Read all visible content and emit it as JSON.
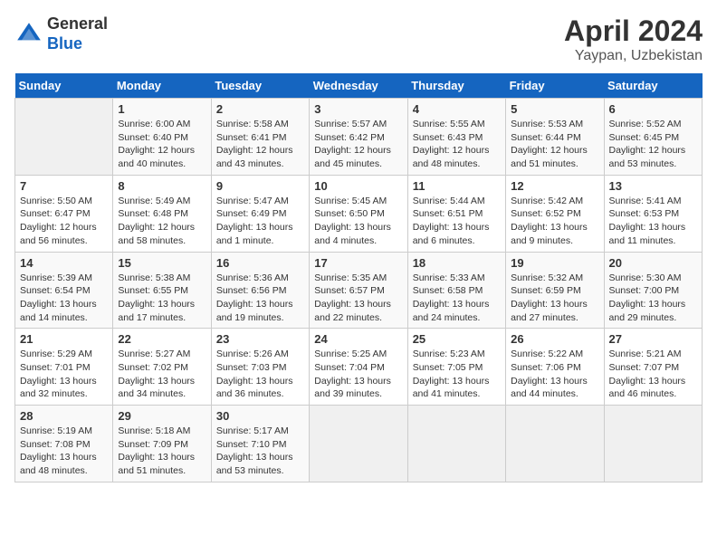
{
  "header": {
    "logo_general": "General",
    "logo_blue": "Blue",
    "title": "April 2024",
    "subtitle": "Yaypan, Uzbekistan"
  },
  "calendar": {
    "days_of_week": [
      "Sunday",
      "Monday",
      "Tuesday",
      "Wednesday",
      "Thursday",
      "Friday",
      "Saturday"
    ],
    "weeks": [
      [
        {
          "day": "",
          "info": ""
        },
        {
          "day": "1",
          "info": "Sunrise: 6:00 AM\nSunset: 6:40 PM\nDaylight: 12 hours\nand 40 minutes."
        },
        {
          "day": "2",
          "info": "Sunrise: 5:58 AM\nSunset: 6:41 PM\nDaylight: 12 hours\nand 43 minutes."
        },
        {
          "day": "3",
          "info": "Sunrise: 5:57 AM\nSunset: 6:42 PM\nDaylight: 12 hours\nand 45 minutes."
        },
        {
          "day": "4",
          "info": "Sunrise: 5:55 AM\nSunset: 6:43 PM\nDaylight: 12 hours\nand 48 minutes."
        },
        {
          "day": "5",
          "info": "Sunrise: 5:53 AM\nSunset: 6:44 PM\nDaylight: 12 hours\nand 51 minutes."
        },
        {
          "day": "6",
          "info": "Sunrise: 5:52 AM\nSunset: 6:45 PM\nDaylight: 12 hours\nand 53 minutes."
        }
      ],
      [
        {
          "day": "7",
          "info": "Sunrise: 5:50 AM\nSunset: 6:47 PM\nDaylight: 12 hours\nand 56 minutes."
        },
        {
          "day": "8",
          "info": "Sunrise: 5:49 AM\nSunset: 6:48 PM\nDaylight: 12 hours\nand 58 minutes."
        },
        {
          "day": "9",
          "info": "Sunrise: 5:47 AM\nSunset: 6:49 PM\nDaylight: 13 hours\nand 1 minute."
        },
        {
          "day": "10",
          "info": "Sunrise: 5:45 AM\nSunset: 6:50 PM\nDaylight: 13 hours\nand 4 minutes."
        },
        {
          "day": "11",
          "info": "Sunrise: 5:44 AM\nSunset: 6:51 PM\nDaylight: 13 hours\nand 6 minutes."
        },
        {
          "day": "12",
          "info": "Sunrise: 5:42 AM\nSunset: 6:52 PM\nDaylight: 13 hours\nand 9 minutes."
        },
        {
          "day": "13",
          "info": "Sunrise: 5:41 AM\nSunset: 6:53 PM\nDaylight: 13 hours\nand 11 minutes."
        }
      ],
      [
        {
          "day": "14",
          "info": "Sunrise: 5:39 AM\nSunset: 6:54 PM\nDaylight: 13 hours\nand 14 minutes."
        },
        {
          "day": "15",
          "info": "Sunrise: 5:38 AM\nSunset: 6:55 PM\nDaylight: 13 hours\nand 17 minutes."
        },
        {
          "day": "16",
          "info": "Sunrise: 5:36 AM\nSunset: 6:56 PM\nDaylight: 13 hours\nand 19 minutes."
        },
        {
          "day": "17",
          "info": "Sunrise: 5:35 AM\nSunset: 6:57 PM\nDaylight: 13 hours\nand 22 minutes."
        },
        {
          "day": "18",
          "info": "Sunrise: 5:33 AM\nSunset: 6:58 PM\nDaylight: 13 hours\nand 24 minutes."
        },
        {
          "day": "19",
          "info": "Sunrise: 5:32 AM\nSunset: 6:59 PM\nDaylight: 13 hours\nand 27 minutes."
        },
        {
          "day": "20",
          "info": "Sunrise: 5:30 AM\nSunset: 7:00 PM\nDaylight: 13 hours\nand 29 minutes."
        }
      ],
      [
        {
          "day": "21",
          "info": "Sunrise: 5:29 AM\nSunset: 7:01 PM\nDaylight: 13 hours\nand 32 minutes."
        },
        {
          "day": "22",
          "info": "Sunrise: 5:27 AM\nSunset: 7:02 PM\nDaylight: 13 hours\nand 34 minutes."
        },
        {
          "day": "23",
          "info": "Sunrise: 5:26 AM\nSunset: 7:03 PM\nDaylight: 13 hours\nand 36 minutes."
        },
        {
          "day": "24",
          "info": "Sunrise: 5:25 AM\nSunset: 7:04 PM\nDaylight: 13 hours\nand 39 minutes."
        },
        {
          "day": "25",
          "info": "Sunrise: 5:23 AM\nSunset: 7:05 PM\nDaylight: 13 hours\nand 41 minutes."
        },
        {
          "day": "26",
          "info": "Sunrise: 5:22 AM\nSunset: 7:06 PM\nDaylight: 13 hours\nand 44 minutes."
        },
        {
          "day": "27",
          "info": "Sunrise: 5:21 AM\nSunset: 7:07 PM\nDaylight: 13 hours\nand 46 minutes."
        }
      ],
      [
        {
          "day": "28",
          "info": "Sunrise: 5:19 AM\nSunset: 7:08 PM\nDaylight: 13 hours\nand 48 minutes."
        },
        {
          "day": "29",
          "info": "Sunrise: 5:18 AM\nSunset: 7:09 PM\nDaylight: 13 hours\nand 51 minutes."
        },
        {
          "day": "30",
          "info": "Sunrise: 5:17 AM\nSunset: 7:10 PM\nDaylight: 13 hours\nand 53 minutes."
        },
        {
          "day": "",
          "info": ""
        },
        {
          "day": "",
          "info": ""
        },
        {
          "day": "",
          "info": ""
        },
        {
          "day": "",
          "info": ""
        }
      ]
    ]
  }
}
